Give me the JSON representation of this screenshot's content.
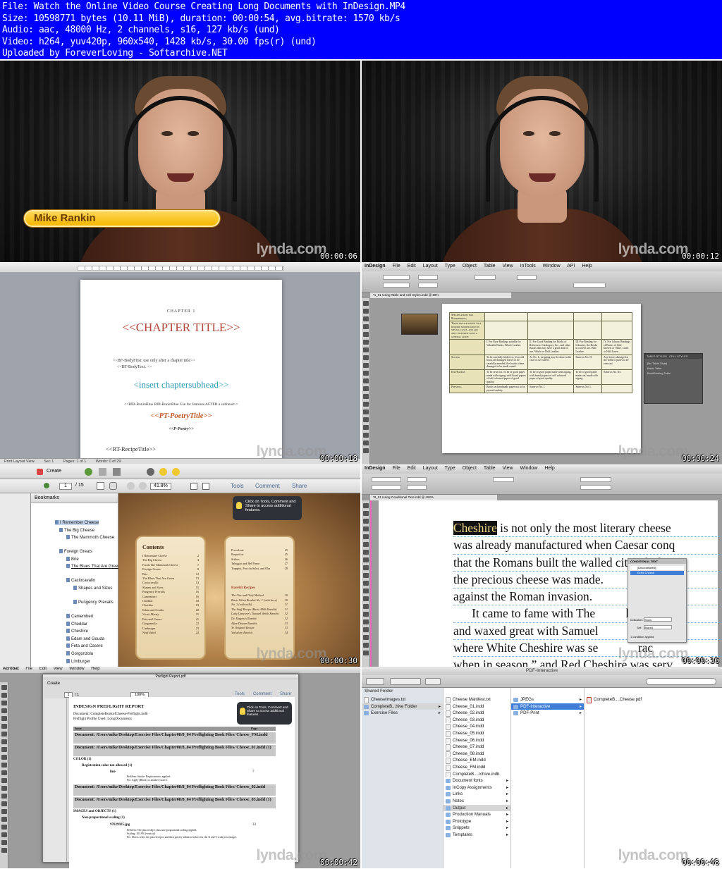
{
  "header": {
    "lines": [
      "File: Watch the Online Video Course Creating Long Documents with InDesign.MP4",
      "Size: 10598771 bytes (10.11 MiB), duration: 00:00:54, avg.bitrate: 1570 kb/s",
      "Audio: aac, 48000 Hz, 2 channels, s16, 127 kb/s (und)",
      "Video: h264, yuv420p, 960x540, 1428 kb/s, 30.00 fps(r) (und)",
      "Uploaded by ForeverLoving - Softarchive.NET"
    ]
  },
  "watermark": "lynda.com",
  "timestamps": [
    "00:00:06",
    "00:00:12",
    "00:00:18",
    "00:00:24",
    "00:00:30",
    "00:00:36",
    "00:00:42",
    "00:00:48"
  ],
  "frame1": {
    "presenter_name": "Mike Rankin"
  },
  "frame3": {
    "chapter_label": "CHAPTER 1",
    "chapter_title": "<<CHAPTER TITLE>>",
    "bf_body_first": "<<BF-BodyFirst: use only after a chapter title>>",
    "bt_body_text": "<<BT-BodyText. >>",
    "subhead": "<insert chaptersubhead>>",
    "rib_runin": "<<RIB-RuninBlue RIB-RuninBlue Use for features AFTER a subhead>>",
    "poetry_title": "<<PT-PoetryTitle>>",
    "poetry": "<<P-Poetry>>",
    "recipe_title": "<<RT-RecipeTitle>>",
    "status": [
      "Print Layout View",
      "Sec 1",
      "Pages: 1 of 1",
      "Words: 0 of 29"
    ]
  },
  "frame4": {
    "menu": [
      "InDesign",
      "File",
      "Edit",
      "Layout",
      "Type",
      "Object",
      "Table",
      "View",
      "InTools",
      "Window",
      "API",
      "Help"
    ],
    "doc_tab": "*1_01 Using Table and Cell Styles.indd @ 89%",
    "col_heads": [
      "I. For Rare Binding, suitable for Valuable Books, Whole Leather.",
      "II. For Good Binding for Books of Reference, Catalogues, &c., and other Books that may have a great deal of use. Whole or Half Leather.",
      "III. For Binding for Libraries, the Books in current use. Half Leather.",
      "IV. For Library Bindings of Books of little Interest or Value. Cloth or Half Linen."
    ],
    "row_heads": [
      "Specifications for Bookbinding",
      "These specifications will require modification in special cases, and are only intended to be a general guide.",
      "Sewing",
      "End-Papers",
      "Pressing"
    ],
    "cells": {
      "sewing": [
        "To be carefully folded, or, if an old book, all damaged leaves to be carefully mended, the books where damaged to be made sound.",
        "As No. I., stripping may be done in the case of two sheets.",
        "Same as No. II.",
        "Any leaves damaged at the folds or plates to be overcast."
      ],
      "endpapers": [
        "To be sewn on. To be of good paper made with zigzag, with board papers of self coloured paper of good quality.",
        "To be of good paper made with zigzag, with board papers of self coloured paper of good quality.",
        "To be of good paper made, on, made with zigzag.",
        "Same as No. III."
      ],
      "pressing": [
        "Books on handmade paper not to be pressed unduly.",
        "Same as No. I.",
        "Same as No. I.",
        ""
      ]
    },
    "panel_tabs": [
      "TABLE STYLES",
      "CELL STYLES"
    ],
    "panel_items": [
      "[No Table Style]",
      "Basic Table",
      "BookBinding Table"
    ]
  },
  "frame5": {
    "toolbar": {
      "create": "Create",
      "page": "1",
      "page_total": "/ 15",
      "zoom": "41.8%",
      "tools": "Tools",
      "comment": "Comment",
      "share": "Share"
    },
    "bookmarks_title": "Bookmarks",
    "bookmarks": [
      "I Remember Cheese",
      "The Big Cheese",
      "The Mammoth Cheese",
      "Foreign Greats",
      "Brie",
      "The Blues That Are Green",
      "Caciocavallo",
      "Shapes and Sizes",
      "Pungency Prevails",
      "Camembert",
      "Cheddar",
      "Cheshire",
      "Edam and Gouda",
      "Feta and Casere",
      "Gorgonzola",
      "Limburger"
    ],
    "tooltip": "Click on Tools, Comment and Share to access additional features.",
    "contents_title": "Contents",
    "contents_left": [
      [
        "I Remember Cheese",
        "2"
      ],
      [
        "The Big Cheese",
        "3"
      ],
      [
        "Foods  The Mammoth Cheese",
        "7"
      ],
      [
        "Foreign Greats",
        "8"
      ],
      [
        "Brie",
        "12"
      ],
      [
        "The Blues That Are Green",
        "13"
      ],
      [
        "Caciocavallo",
        "14"
      ],
      [
        "Shapes and Sizes",
        "15"
      ],
      [
        "Pungency Prevails",
        "16"
      ],
      [
        "Camembert",
        "16"
      ],
      [
        "Cheddar",
        "18"
      ],
      [
        "Cheshire",
        "19"
      ],
      [
        "Edam and Gouda",
        "20"
      ],
      [
        "Victor Meusy",
        "21"
      ],
      [
        "Feta and Casere",
        "21"
      ],
      [
        "Gorgonzola",
        "22"
      ],
      [
        "Limburger",
        "23"
      ],
      [
        "Neufchâtel",
        "24"
      ]
    ],
    "contents_right": [
      [
        "Provolone",
        "25"
      ],
      [
        "Roquefort",
        "25"
      ],
      [
        "Stilton",
        "26"
      ],
      [
        "Taleggio and Bel Paese",
        "27"
      ],
      [
        "Trappist, Port du Salut, and Oka",
        "28"
      ]
    ],
    "rarebit_title": "Rarebit Recipes",
    "rarebit": [
      [
        "The One and Only Method",
        "30"
      ],
      [
        "Basic Welsh Rarebit No. 1 (with beer)",
        "30"
      ],
      [
        "No. 2 (with milk)",
        "31"
      ],
      [
        "The Stuff Recipe (Basic Milk Rarebit)",
        "31"
      ],
      [
        "Lady Llanover's Toasted Welsh Rarebit",
        "32"
      ],
      [
        "Dr. Magiru's Rarebit",
        "32"
      ],
      [
        "After-Dinner Rarebit",
        "33"
      ],
      [
        "Ye Original Recipe",
        "33"
      ],
      [
        "Yorkshire Rarebit",
        "34"
      ]
    ]
  },
  "frame6": {
    "menu": [
      "InDesign",
      "File",
      "Edit",
      "Layout",
      "Type",
      "Object",
      "Table",
      "View",
      "Window",
      "Help"
    ],
    "doc_tab": "*8_01 Using Conditional Text.indd @ 492%",
    "lines": [
      {
        "hl": "Cheshire",
        "rest": " is not only the most literary cheese"
      },
      {
        "hl": "",
        "rest": "was already manufactured when Caesar conq"
      },
      {
        "hl": "",
        "rest": "that the Romans built the walled city of Chest"
      },
      {
        "hl": "",
        "rest": "the precious cheese was made.              n th"
      },
      {
        "hl": "",
        "rest": "against the Roman invasion."
      },
      {
        "hl": "",
        "rest": "      It came to fame with The          hire"
      },
      {
        "hl": "",
        "rest": "and waxed great with Samuel           pres"
      },
      {
        "hl": "",
        "rest": "where White Cheshire was se             rac"
      },
      {
        "hl": "",
        "rest": "when in season,” and Red Cheshire was serv"
      }
    ],
    "cond_panel": {
      "title": "CONDITIONAL TEXT",
      "items": [
        "[Unconditional]",
        "Extra Cheese"
      ],
      "indicators_label": "Indicators:",
      "indicators_value": "Show",
      "set_label": "Set:",
      "set_value": "[None]",
      "applied": "1 condition applied"
    }
  },
  "frame7": {
    "menu": [
      "Acrobat",
      "File",
      "Edit",
      "View",
      "Window",
      "Help"
    ],
    "doc_title": "Preflight Report.pdf",
    "toolbar": {
      "create": "Create",
      "page": "1",
      "page_total": "/ 1",
      "zoom": "100%",
      "tools": "Tools",
      "comment": "Comment",
      "share": "Share"
    },
    "tooltip": "Click on Tools, Comment and Share to access additional features.",
    "report_title": "INDESIGN PREFLIGHT REPORT",
    "document_line": "Document: CompleteBookofCheese-Preflight.indb",
    "profile_line": "Preflight Profile Used: LongDocuments",
    "col_issue": "Issue",
    "col_page": "Page",
    "doc1": "Document: /Users/mike/Desktop/Exercise Files/Chapter08/8_04 Preflighting Book Files/ Cheese_FM.indd",
    "doc2": "Document: /Users/mike/Desktop/Exercise Files/Chapter08/8_04 Preflighting Book Files/ Cheese_01.indd (1)",
    "color": "COLOR (1)",
    "reg_color": "Registration color not allowed (1)",
    "line": "line",
    "line_page": "7",
    "problem1": "Problem: Stroke: Registration is applied.",
    "fix1": "Fix: Apply [Black] or another swatch.",
    "doc3": "Document: /Users/mike/Desktop/Exercise Files/Chapter08/8_04 Preflighting Book Files/ Cheese_02.indd",
    "doc4": "Document: /Users/mike/Desktop/Exercise Files/Chapter08/8_04 Preflighting Book Files/ Cheese_03.indd (1)",
    "images": "IMAGES and OBJECTS (1)",
    "nonprop": "Non-proportional scaling (1)",
    "jpg": "97829925.jpg",
    "jpg_page": "33",
    "problem2": "Problem: The placed object has non-proportional scaling applied.",
    "info2": "Scaling: 103.9% (vertical)",
    "fix2": "Fix: Direct select the placed object and then specify identical values for the X and Y scale percentages."
  },
  "frame8": {
    "window_title": "PDF-Interactive",
    "sidebar_header": "Shared Folder",
    "col1": [
      {
        "name": "CheeseImages.txt",
        "kind": "file"
      },
      {
        "name": "CompleteB...hive Folder",
        "kind": "folder",
        "state": "grey",
        "arrow": true
      },
      {
        "name": "Exercise Files",
        "kind": "folder",
        "arrow": true
      }
    ],
    "col2": [
      {
        "name": "Cheese Manifest.txt",
        "kind": "file"
      },
      {
        "name": "Cheese_01.indd",
        "kind": "file"
      },
      {
        "name": "Cheese_02.indd",
        "kind": "file"
      },
      {
        "name": "Cheese_03.indd",
        "kind": "file"
      },
      {
        "name": "Cheese_04.indd",
        "kind": "file"
      },
      {
        "name": "Cheese_05.indd",
        "kind": "file"
      },
      {
        "name": "Cheese_06.indd",
        "kind": "file"
      },
      {
        "name": "Cheese_07.indd",
        "kind": "file"
      },
      {
        "name": "Cheese_08.indd",
        "kind": "file"
      },
      {
        "name": "Cheese_EM.indd",
        "kind": "file"
      },
      {
        "name": "Cheese_FM.indd",
        "kind": "file"
      },
      {
        "name": "CompleteB....rchive.indb",
        "kind": "file"
      },
      {
        "name": "Document fonts",
        "kind": "folder",
        "arrow": true
      },
      {
        "name": "InCopy Assignments",
        "kind": "folder",
        "arrow": true
      },
      {
        "name": "Links",
        "kind": "folder",
        "arrow": true
      },
      {
        "name": "Notes",
        "kind": "folder",
        "arrow": true
      },
      {
        "name": "Output",
        "kind": "folder",
        "state": "grey",
        "arrow": true
      },
      {
        "name": "Production Manuals",
        "kind": "folder",
        "arrow": true
      },
      {
        "name": "Prototype",
        "kind": "folder",
        "arrow": true
      },
      {
        "name": "Snippets",
        "kind": "folder",
        "arrow": true
      },
      {
        "name": "Templates",
        "kind": "folder",
        "arrow": true
      }
    ],
    "col3": [
      {
        "name": "JPEGs",
        "kind": "folder",
        "arrow": true
      },
      {
        "name": "PDF-Interactive",
        "kind": "folder",
        "state": "sel",
        "arrow": true
      },
      {
        "name": "PDF-Print",
        "kind": "folder",
        "arrow": true
      }
    ],
    "col4": [
      {
        "name": "CompleteB....Cheese.pdf",
        "kind": "pdf"
      }
    ]
  }
}
